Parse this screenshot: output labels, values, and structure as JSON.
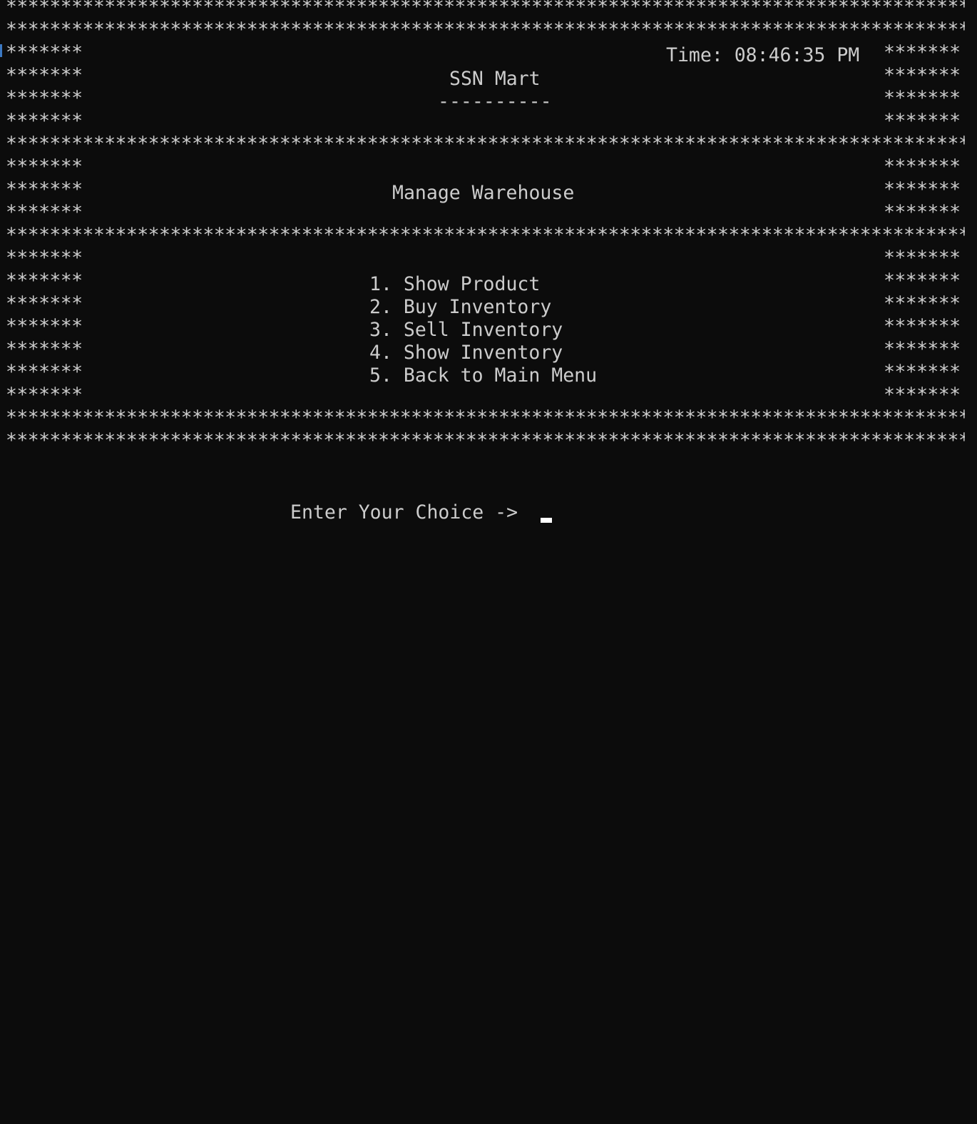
{
  "border": {
    "full_line": "************************************************************************************************************************",
    "side": "*******"
  },
  "header": {
    "time_label": "Time: 08:46:35 PM",
    "title": "SSN Mart",
    "underline": "----------"
  },
  "section": {
    "title": "Manage Warehouse"
  },
  "menu": {
    "items": [
      "1. Show Product",
      "2. Buy Inventory",
      "3. Sell Inventory",
      "4. Show Inventory",
      "5. Back to Main Menu"
    ]
  },
  "prompt": {
    "text": "Enter Your Choice ->"
  }
}
